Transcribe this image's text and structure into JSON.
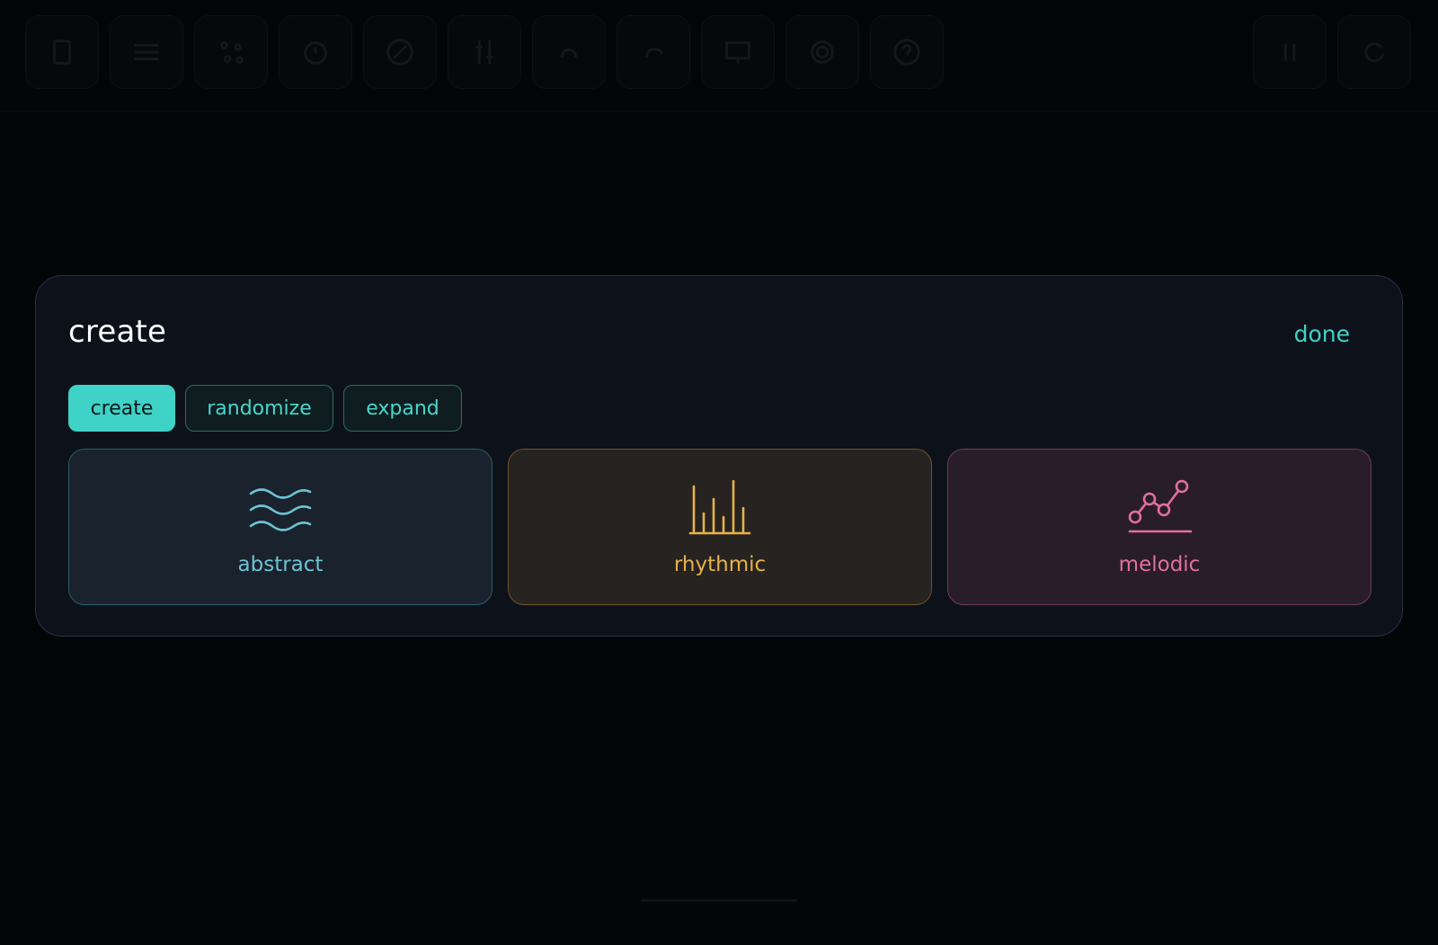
{
  "toolbar": {
    "left_buttons": [
      "document-icon",
      "list-icon",
      "shuffle-icon",
      "timer-icon",
      "compass-icon",
      "mixer-icon",
      "undo-icon",
      "redo-icon",
      "presentation-icon",
      "settings-icon",
      "help-icon"
    ],
    "right_buttons": [
      "pause-icon",
      "refresh-icon"
    ]
  },
  "modal": {
    "title": "create",
    "done_label": "done",
    "tabs": [
      {
        "label": "create",
        "active": true
      },
      {
        "label": "randomize",
        "active": false
      },
      {
        "label": "expand",
        "active": false
      }
    ],
    "cards": [
      {
        "label": "abstract",
        "icon": "waves-icon",
        "color": "#6cc3d4"
      },
      {
        "label": "rhythmic",
        "icon": "bars-icon",
        "color": "#e7b14b"
      },
      {
        "label": "melodic",
        "icon": "melody-line-icon",
        "color": "#e0709f"
      }
    ]
  },
  "colors": {
    "accent": "#3fd2c7",
    "background": "#040507",
    "panel": "#0d121a"
  }
}
